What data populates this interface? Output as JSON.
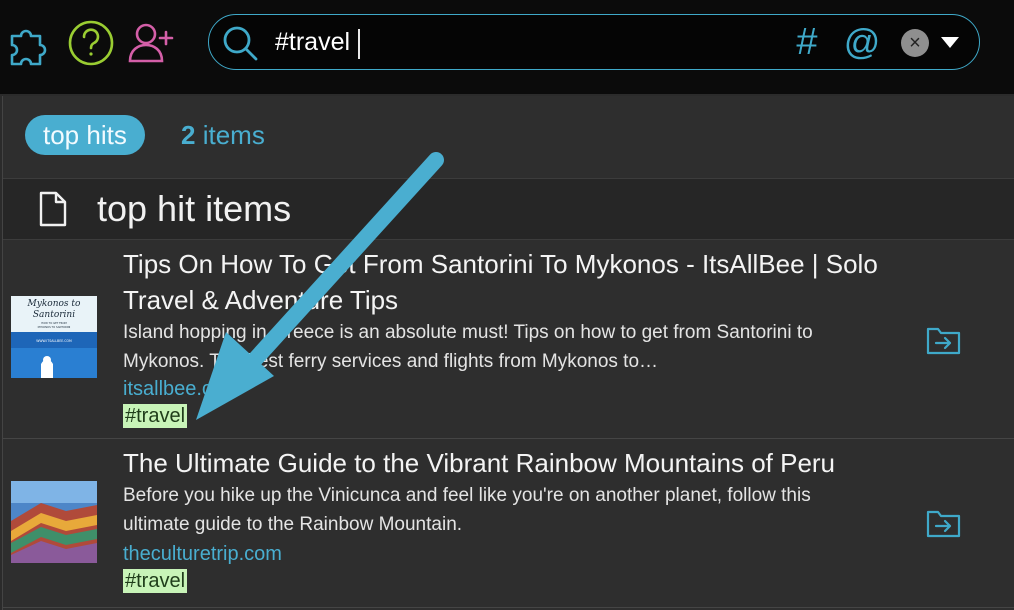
{
  "toolbar": {
    "icons": [
      "puzzle-icon",
      "help-icon",
      "add-user-icon"
    ],
    "accent": "#3fa9c9",
    "help_color": "#9acd32",
    "add_user_color": "#d45fa8"
  },
  "search": {
    "query": "#travel",
    "hashtag_label": "#",
    "mention_label": "@",
    "clear_label": "×"
  },
  "filter": {
    "pill_label": "top hits",
    "count": "2",
    "count_label": "items"
  },
  "section": {
    "title": "top hit items"
  },
  "results": [
    {
      "title": "Tips On How To Get From Santorini To Mykonos - ItsAllBee | Solo Travel & Adventure Tips",
      "description": "Island hopping in Greece is an absolute must! Tips on how to get from Santorini to Mykonos. The best ferry services and flights from Mykonos to…",
      "source": "itsallbee.com",
      "tag": "#travel",
      "thumbnail_text": [
        "Mykonos to",
        "Santorini",
        "HOW TO GET FROM",
        "MYKONOS TO SANTORINI",
        "WWW.ITSALLBEE.COM"
      ]
    },
    {
      "title": "The Ultimate Guide to the Vibrant Rainbow Mountains of Peru",
      "description": "Before you hike up the Vinicunca and feel like you're on another planet, follow this ultimate guide to the Rainbow Mountain.",
      "source": "theculturetrip.com",
      "tag": "#travel"
    }
  ],
  "colors": {
    "accent": "#49aed0",
    "tag_bg": "#c8f4b8",
    "annotation_arrow": "#4aaed0"
  }
}
